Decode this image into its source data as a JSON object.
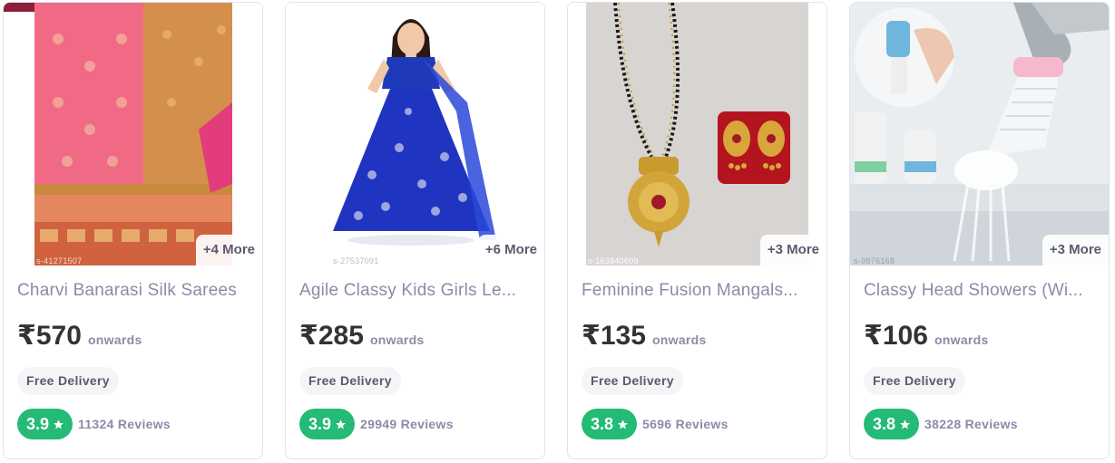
{
  "products": [
    {
      "title": "Charvi Banarasi Silk Sarees",
      "price": "₹570",
      "onwards_label": "onwards",
      "more_label": "+4 More",
      "delivery_label": "Free Delivery",
      "rating": "3.9",
      "reviews": "11324 Reviews",
      "watermark": "s-41271507"
    },
    {
      "title": "Agile Classy Kids Girls Le...",
      "price": "₹285",
      "onwards_label": "onwards",
      "more_label": "+6 More",
      "delivery_label": "Free Delivery",
      "rating": "3.9",
      "reviews": "29949 Reviews",
      "watermark": "s-27537091"
    },
    {
      "title": "Feminine Fusion Mangals...",
      "price": "₹135",
      "onwards_label": "onwards",
      "more_label": "+3 More",
      "delivery_label": "Free Delivery",
      "rating": "3.8",
      "reviews": "5696 Reviews",
      "watermark": "s-163840609"
    },
    {
      "title": "Classy Head Showers (Wi...",
      "price": "₹106",
      "onwards_label": "onwards",
      "more_label": "+3 More",
      "delivery_label": "Free Delivery",
      "rating": "3.8",
      "reviews": "38228 Reviews",
      "watermark": "s-9876168"
    }
  ],
  "colors": {
    "rating_green": "#23bb75",
    "muted_text": "#8b8ba7",
    "price_text": "#333333",
    "card_border": "#dfe3ec"
  },
  "icons": {
    "rating": "star-icon"
  }
}
